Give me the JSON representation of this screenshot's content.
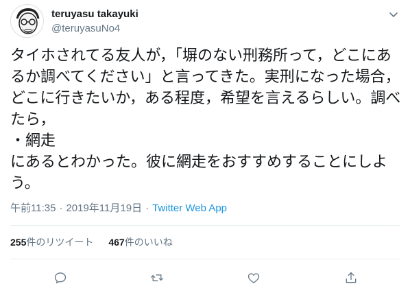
{
  "user": {
    "display_name": "teruyasu takayuki",
    "handle": "@teruyasuNo4",
    "avatar_icon": "cartoon-face-avatar"
  },
  "tweet": {
    "text": "タイホされてる友人が，「塀のない刑務所って，どこにあるか調べてください」と言ってきた。実刑になった場合，どこに行きたいか，ある程度，希望を言えるらしい。調べたら，\n・網走\nにあるとわかった。彼に網走をおすすめすることにしよう。"
  },
  "meta": {
    "time": "午前11:35",
    "separator1": "·",
    "date": "2019年11月19日",
    "separator2": "·",
    "source": "Twitter Web App"
  },
  "stats": {
    "retweets_count": "255",
    "retweets_label": "件のリツイート",
    "likes_count": "467",
    "likes_label": "件のいいね"
  },
  "colors": {
    "text": "#14171a",
    "secondary": "#657786",
    "link": "#1b95e0",
    "divider": "#e6ecf0"
  },
  "icons": {
    "menu": "chevron-down-icon",
    "reply": "reply-icon",
    "retweet": "retweet-icon",
    "like": "heart-icon",
    "share": "share-icon"
  }
}
